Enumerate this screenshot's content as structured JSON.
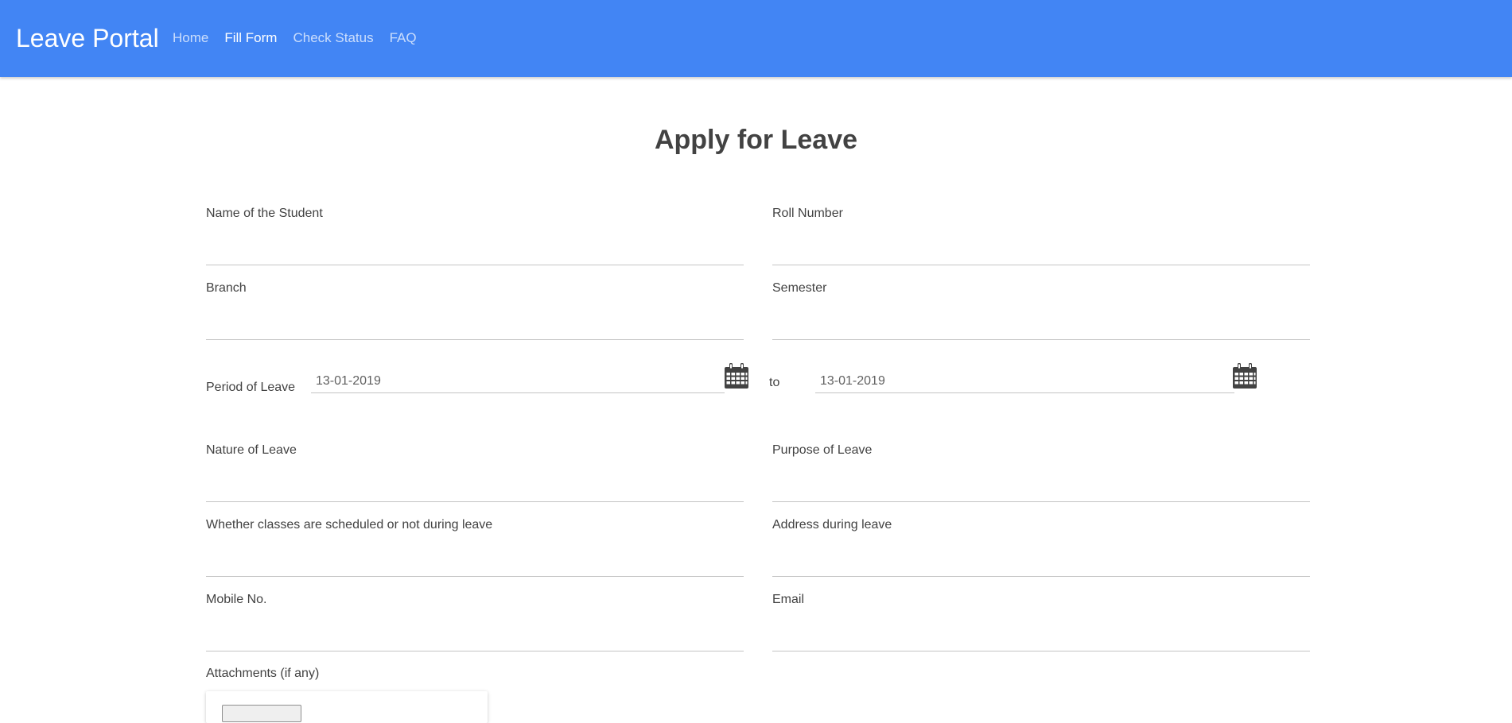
{
  "navbar": {
    "brand": "Leave Portal",
    "links": [
      "Home",
      "Fill Form",
      "Check Status",
      "FAQ"
    ],
    "active_link": "Fill Form"
  },
  "colors": {
    "navbar_bg": "#4285f4",
    "text": "#424242",
    "underline": "#c4c4c4"
  },
  "form": {
    "title": "Apply for Leave",
    "fields": {
      "student_name": {
        "label": "Name of the Student",
        "value": ""
      },
      "roll_number": {
        "label": "Roll Number",
        "value": ""
      },
      "branch": {
        "label": "Branch",
        "value": ""
      },
      "semester": {
        "label": "Semester",
        "value": ""
      },
      "nature": {
        "label": "Nature of Leave",
        "value": ""
      },
      "purpose": {
        "label": "Purpose of Leave",
        "value": ""
      },
      "classes": {
        "label": "Whether classes are scheduled or not during leave",
        "value": ""
      },
      "address": {
        "label": "Address during leave",
        "value": ""
      },
      "mobile": {
        "label": "Mobile No.",
        "value": ""
      },
      "email": {
        "label": "Email",
        "value": ""
      }
    },
    "period": {
      "label": "Period of Leave",
      "from": "13-01-2019",
      "to_label": "to",
      "to": "13-01-2019",
      "icon": "calendar-icon"
    },
    "attachments": {
      "label": "Attachments (if any)"
    }
  }
}
